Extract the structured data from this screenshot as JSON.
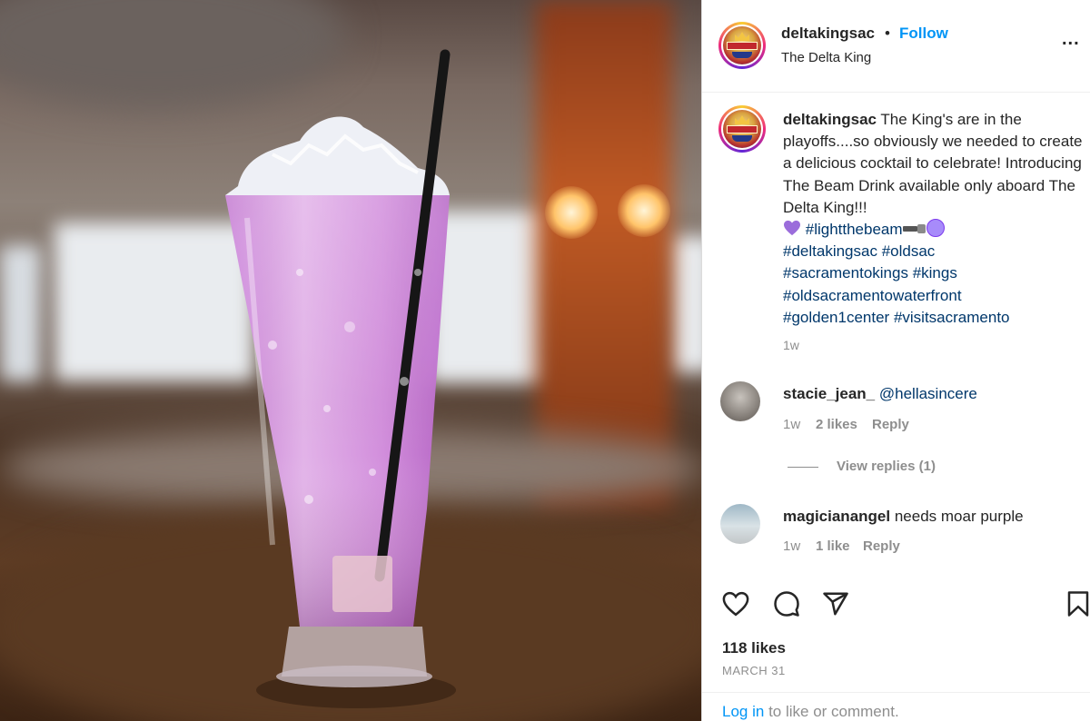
{
  "post": {
    "username": "deltakingsac",
    "follow_label": "Follow",
    "separator": "•",
    "location": "The Delta King",
    "more_label": "...",
    "caption_text": "The King's are in the playoffs....so obviously we needed to create a delicious cocktail to celebrate! Introducing The Beam Drink available only aboard The Delta King!!!",
    "hashtags_line1": "#lightthebeam",
    "hashtags": [
      "#deltakingsac",
      "#oldsac",
      "#sacramentokings",
      "#kings",
      "#oldsacramentowaterfront",
      "#golden1center",
      "#visitsacramento"
    ],
    "caption_time": "1w",
    "likes": "118 likes",
    "date": "MARCH 31"
  },
  "comments": [
    {
      "username": "stacie_jean_",
      "text": "@hellasincere",
      "time": "1w",
      "likes": "2 likes",
      "reply_label": "Reply",
      "view_replies": "View replies (1)"
    },
    {
      "username": "magicianangel",
      "text": "needs moar purple",
      "time": "1w",
      "likes": "1 like",
      "reply_label": "Reply"
    }
  ],
  "footer": {
    "login_link": "Log in",
    "login_text": "to like or comment."
  },
  "icons": [
    "heart-icon",
    "comment-icon",
    "share-icon",
    "bookmark-icon",
    "more-icon"
  ],
  "colors": {
    "accent": "#0095f6",
    "hashtag": "#00376b",
    "muted": "#8e8e8e",
    "text": "#262626"
  }
}
